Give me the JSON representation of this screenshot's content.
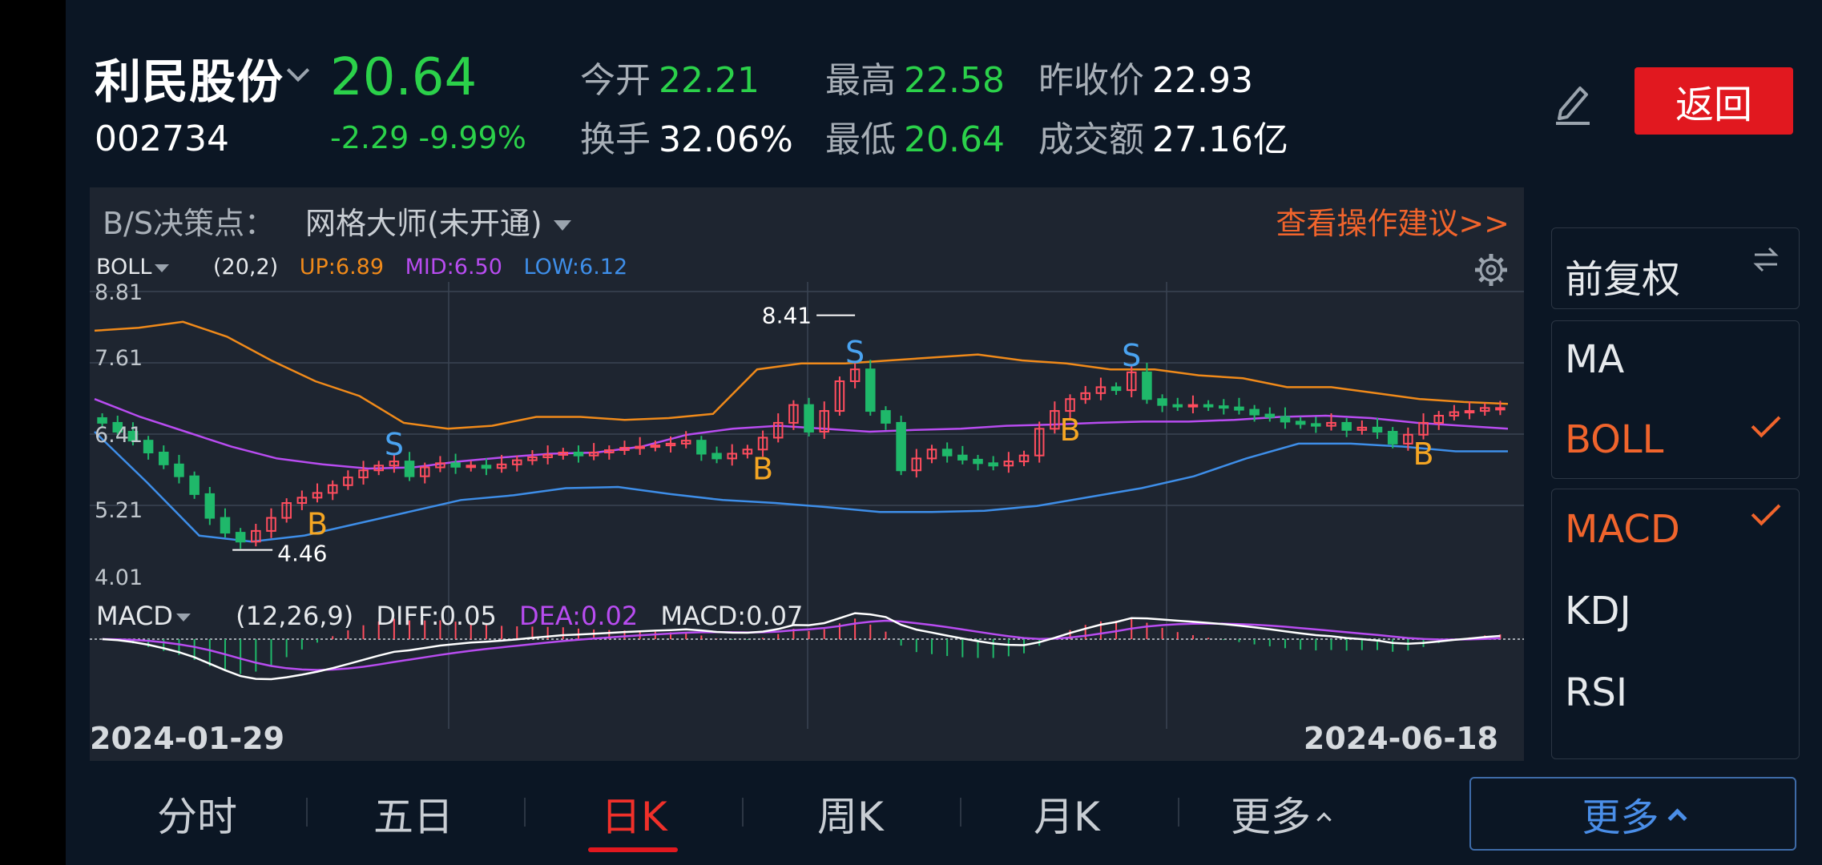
{
  "header": {
    "name": "利民股份",
    "code": "002734",
    "price": "20.64",
    "change": "-2.29 -9.99%",
    "stats": {
      "open_label": "今开",
      "open": "22.21",
      "high_label": "最高",
      "high": "22.58",
      "prev_close_label": "昨收价",
      "prev_close": "22.93",
      "turnover_label": "换手",
      "turnover": "32.06%",
      "low_label": "最低",
      "low": "20.64",
      "amount_label": "成交额",
      "amount": "27.16亿"
    },
    "back_label": "返回"
  },
  "colors": {
    "up": "#ff4d5e",
    "down": "#1fb86a",
    "boll_up": "#f08a1a",
    "boll_mid": "#b84cf0",
    "boll_low": "#3e8ee8",
    "buy": "#f5a623",
    "sell": "#4aa3f0",
    "accent": "#f0642c"
  },
  "icons": [
    "chevron-down-icon",
    "edit-icon",
    "settings-icon",
    "swap-icon",
    "check-icon",
    "chevron-up-icon"
  ],
  "chart": {
    "bs_label": "B/S决策点：",
    "bs_strategy": "网格大师(未开通)",
    "bs_advice": "查看操作建议>>",
    "boll": {
      "name": "BOLL",
      "params": "(20,2)",
      "up": "UP:6.89",
      "mid": "MID:6.50",
      "low": "LOW:6.12"
    },
    "macd": {
      "name": "MACD",
      "params": "(12,26,9)",
      "diff": "DIFF:0.05",
      "dea": "DEA:0.02",
      "macd": "MACD:0.07"
    },
    "y_ticks": [
      "8.81",
      "7.61",
      "6.41",
      "5.21",
      "4.01"
    ],
    "max_label": "8.41",
    "min_label": "4.46",
    "date_start": "2024-01-29",
    "date_end": "2024-06-18",
    "signals": [
      {
        "type": "B",
        "label": "B"
      },
      {
        "type": "S",
        "label": "S"
      },
      {
        "type": "B",
        "label": "B"
      },
      {
        "type": "S",
        "label": "S"
      },
      {
        "type": "B",
        "label": "B"
      },
      {
        "type": "S",
        "label": "S"
      },
      {
        "type": "B",
        "label": "B"
      }
    ]
  },
  "chart_data": {
    "type": "candlestick",
    "y_range": [
      4.01,
      8.81
    ],
    "x_range": [
      "2024-01-29",
      "2024-06-18"
    ],
    "max_price": 8.41,
    "min_price": 4.46,
    "close_series": [
      6.6,
      6.45,
      6.3,
      6.1,
      5.9,
      5.7,
      5.4,
      5.0,
      4.75,
      4.6,
      4.78,
      5.0,
      5.25,
      5.34,
      5.42,
      5.55,
      5.68,
      5.8,
      5.88,
      5.95,
      5.7,
      5.85,
      5.92,
      5.86,
      5.88,
      5.84,
      5.9,
      5.97,
      6.02,
      6.06,
      6.1,
      6.05,
      6.1,
      6.14,
      6.18,
      6.2,
      6.22,
      6.25,
      6.3,
      6.08,
      6.0,
      6.08,
      6.15,
      6.35,
      6.6,
      6.9,
      6.45,
      6.8,
      7.3,
      7.5,
      6.8,
      6.6,
      5.8,
      6.0,
      6.15,
      6.05,
      5.98,
      5.92,
      5.88,
      5.95,
      6.05,
      6.5,
      6.8,
      7.0,
      7.1,
      7.2,
      7.15,
      7.45,
      7.0,
      6.9,
      6.88,
      6.9,
      6.88,
      6.86,
      6.82,
      6.74,
      6.7,
      6.62,
      6.58,
      6.55,
      6.6,
      6.48,
      6.52,
      6.45,
      6.25,
      6.4,
      6.6,
      6.72,
      6.78,
      6.8,
      6.85,
      6.85
    ],
    "series": [
      {
        "name": "UP",
        "values": [
          8.15,
          8.2,
          8.3,
          8.05,
          7.65,
          7.3,
          7.05,
          6.6,
          6.5,
          6.55,
          6.7,
          6.7,
          6.65,
          6.68,
          6.75,
          7.5,
          7.6,
          7.6,
          7.65,
          7.7,
          7.75,
          7.65,
          7.6,
          7.5,
          7.5,
          7.4,
          7.35,
          7.2,
          7.2,
          7.1,
          7.0,
          6.95,
          6.92
        ]
      },
      {
        "name": "MID",
        "values": [
          7.0,
          6.7,
          6.45,
          6.2,
          6.0,
          5.9,
          5.83,
          5.85,
          5.95,
          6.02,
          6.08,
          6.1,
          6.2,
          6.4,
          6.5,
          6.55,
          6.5,
          6.45,
          6.48,
          6.5,
          6.55,
          6.57,
          6.6,
          6.62,
          6.62,
          6.65,
          6.7,
          6.72,
          6.68,
          6.6,
          6.55,
          6.5
        ]
      },
      {
        "name": "LOW",
        "values": [
          6.45,
          5.6,
          4.7,
          4.6,
          4.7,
          4.9,
          5.1,
          5.3,
          5.38,
          5.5,
          5.52,
          5.4,
          5.3,
          5.25,
          5.18,
          5.1,
          5.1,
          5.12,
          5.2,
          5.35,
          5.5,
          5.7,
          6.0,
          6.25,
          6.25,
          6.2,
          6.12,
          6.12
        ]
      }
    ],
    "macd": {
      "DIFF": 0.05,
      "DEA": 0.02,
      "MACD": 0.07
    }
  },
  "side_panel": {
    "adjust": "前复权",
    "main_indicators": [
      {
        "label": "MA",
        "checked": false
      },
      {
        "label": "BOLL",
        "checked": true
      }
    ],
    "sub_indicators": [
      {
        "label": "MACD",
        "checked": true
      },
      {
        "label": "KDJ",
        "checked": false
      },
      {
        "label": "RSI",
        "checked": false
      }
    ]
  },
  "tabs": [
    {
      "label": "分时",
      "active": false
    },
    {
      "label": "五日",
      "active": false
    },
    {
      "label": "日K",
      "active": true
    },
    {
      "label": "周K",
      "active": false
    },
    {
      "label": "月K",
      "active": false
    },
    {
      "label": "更多",
      "active": false
    }
  ],
  "more_button": "更多"
}
